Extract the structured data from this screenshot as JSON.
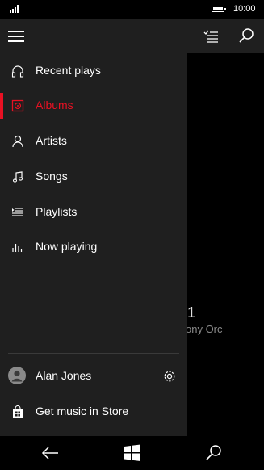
{
  "status_bar": {
    "time": "10:00"
  },
  "background": {
    "number": "1",
    "subtitle": "ony Orc"
  },
  "nav": {
    "items": [
      {
        "label": "Recent plays",
        "icon": "headphones-icon"
      },
      {
        "label": "Albums",
        "icon": "album-icon",
        "selected": true
      },
      {
        "label": "Artists",
        "icon": "person-icon"
      },
      {
        "label": "Songs",
        "icon": "music-note-icon"
      },
      {
        "label": "Playlists",
        "icon": "playlist-icon"
      },
      {
        "label": "Now playing",
        "icon": "equalizer-icon"
      }
    ],
    "user": {
      "name": "Alan Jones"
    },
    "store": {
      "label": "Get music in Store"
    }
  },
  "colors": {
    "accent": "#e81123",
    "pane": "#1f1f1f"
  }
}
